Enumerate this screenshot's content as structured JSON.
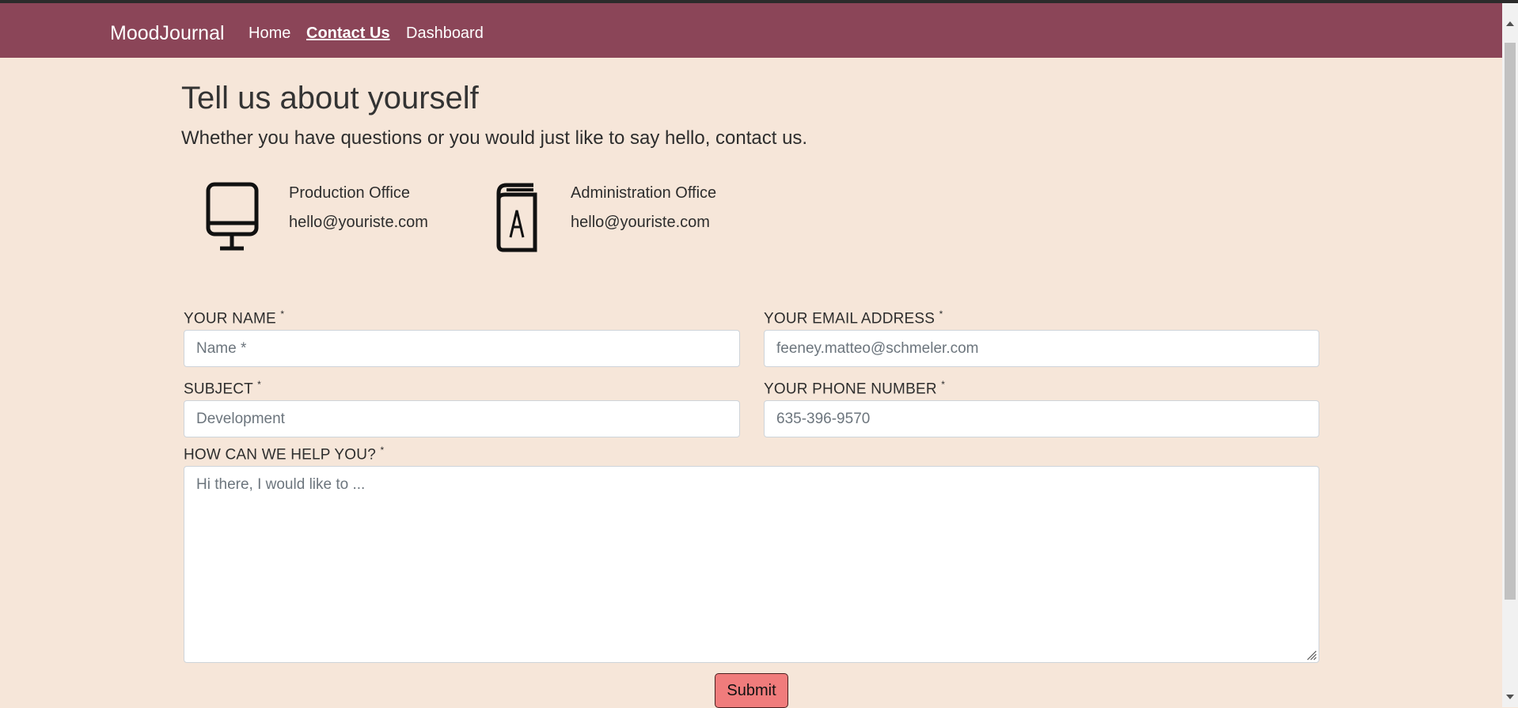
{
  "navbar": {
    "brand": "MoodJournal",
    "links": [
      {
        "label": "Home",
        "active": false
      },
      {
        "label": "Contact Us",
        "active": true
      },
      {
        "label": "Dashboard",
        "active": false
      }
    ]
  },
  "hero": {
    "title": "Tell us about yourself",
    "subtitle": "Whether you have questions or you would just like to say hello, contact us."
  },
  "offices": [
    {
      "icon": "monitor-icon",
      "name": "Production Office",
      "email": "hello@youriste.com"
    },
    {
      "icon": "book-icon",
      "name": "Administration Office",
      "email": "hello@youriste.com"
    }
  ],
  "form": {
    "name": {
      "label": "YOUR NAME",
      "required_mark": "*",
      "placeholder": "Name *",
      "value": ""
    },
    "email": {
      "label": "YOUR EMAIL ADDRESS",
      "required_mark": "*",
      "placeholder": "feeney.matteo@schmeler.com",
      "value": ""
    },
    "subject": {
      "label": "SUBJECT",
      "required_mark": "*",
      "placeholder": "Development",
      "value": ""
    },
    "phone": {
      "label": "YOUR PHONE NUMBER",
      "required_mark": "*",
      "placeholder": "635-396-9570",
      "value": ""
    },
    "message": {
      "label": "HOW CAN WE HELP YOU?",
      "required_mark": "*",
      "placeholder": "Hi there, I would like to ...",
      "value": ""
    },
    "submit_label": "Submit"
  },
  "colors": {
    "navbar_bg": "#8b4558",
    "page_bg": "#f6e6d9",
    "submit_bg": "#f07c7c"
  }
}
